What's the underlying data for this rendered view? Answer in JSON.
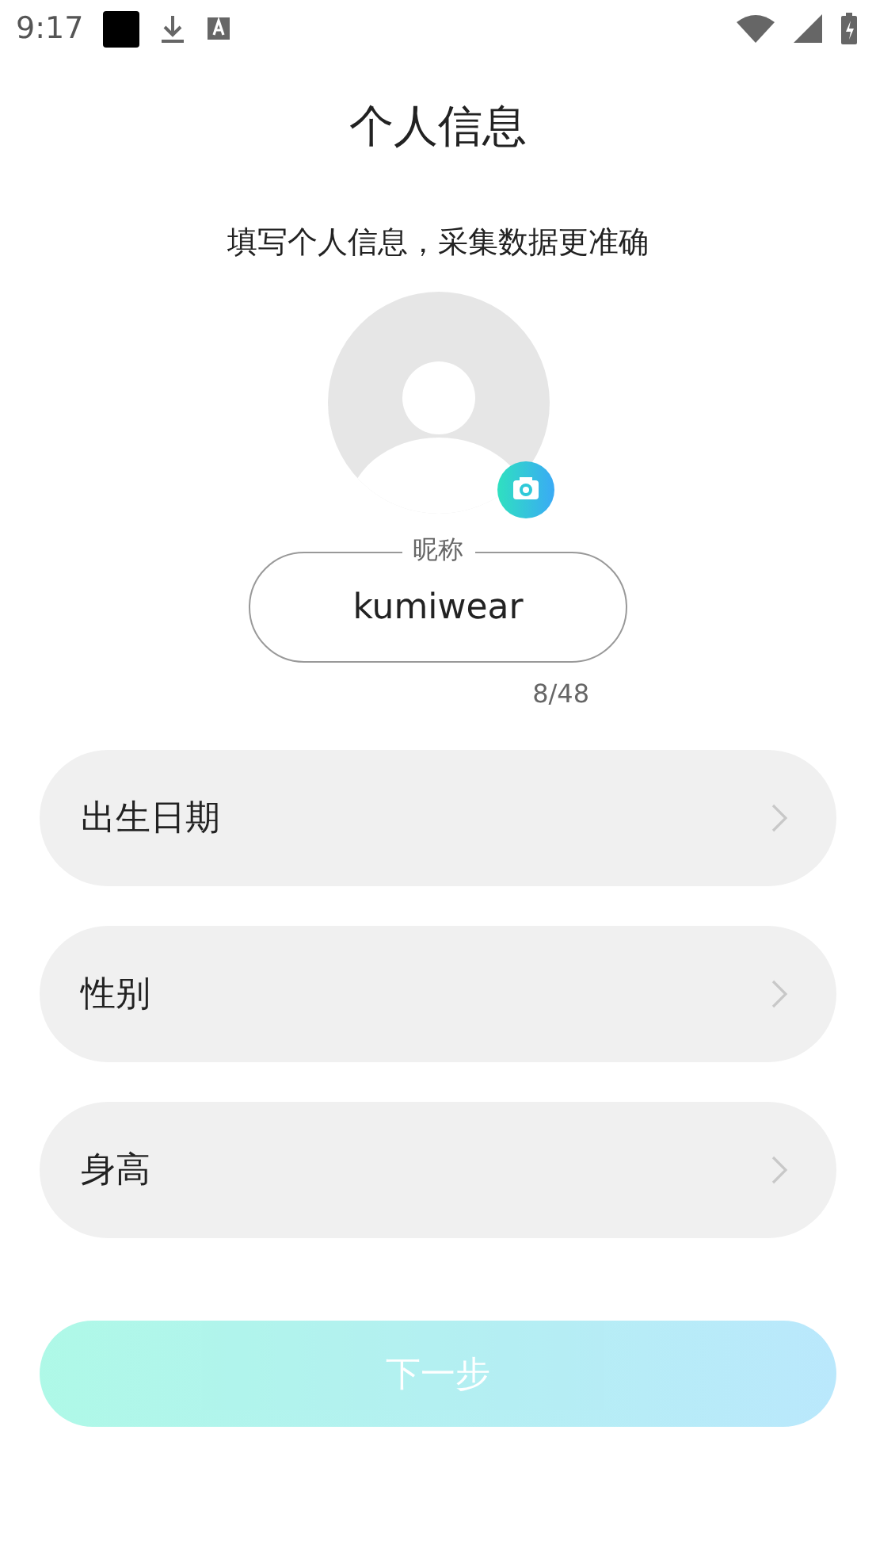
{
  "status_bar": {
    "time": "9:17"
  },
  "title": "个人信息",
  "subtitle": "填写个人信息，采集数据更准确",
  "nickname": {
    "label": "昵称",
    "value": "kumiwear",
    "counter": "8/48"
  },
  "rows": [
    {
      "label": "出生日期"
    },
    {
      "label": "性别"
    },
    {
      "label": "身高"
    }
  ],
  "next_button": {
    "label": "下一步",
    "disabled": true
  }
}
